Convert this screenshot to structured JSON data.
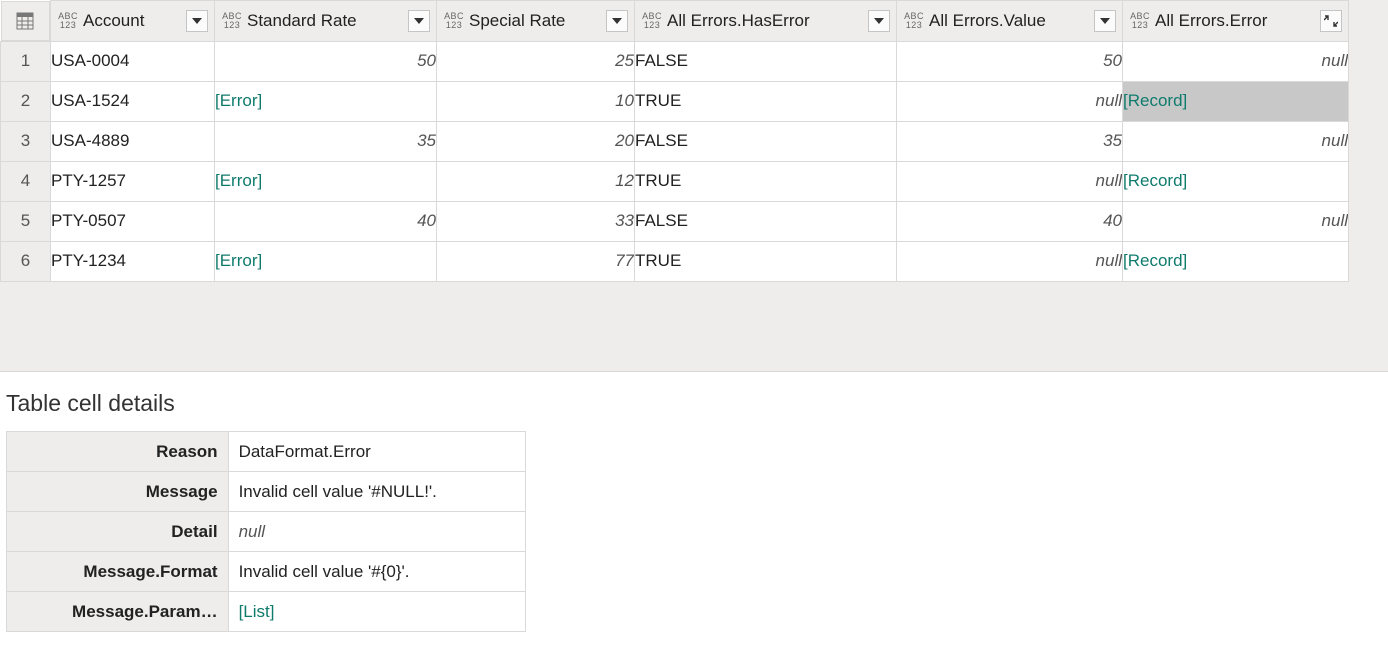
{
  "columns": {
    "account": "Account",
    "standardRate": "Standard Rate",
    "specialRate": "Special Rate",
    "hasError": "All Errors.HasError",
    "value": "All Errors.Value",
    "error": "All Errors.Error"
  },
  "rows": [
    {
      "n": "1",
      "account": "USA-0004",
      "std": "50",
      "std_is_err": false,
      "spc": "25",
      "has": "FALSE",
      "val": "50",
      "val_null": false,
      "err": "null",
      "err_link": false
    },
    {
      "n": "2",
      "account": "USA-1524",
      "std": "[Error]",
      "std_is_err": true,
      "spc": "10",
      "has": "TRUE",
      "val": "null",
      "val_null": true,
      "err": "[Record]",
      "err_link": true
    },
    {
      "n": "3",
      "account": "USA-4889",
      "std": "35",
      "std_is_err": false,
      "spc": "20",
      "has": "FALSE",
      "val": "35",
      "val_null": false,
      "err": "null",
      "err_link": false
    },
    {
      "n": "4",
      "account": "PTY-1257",
      "std": "[Error]",
      "std_is_err": true,
      "spc": "12",
      "has": "TRUE",
      "val": "null",
      "val_null": true,
      "err": "[Record]",
      "err_link": true
    },
    {
      "n": "5",
      "account": "PTY-0507",
      "std": "40",
      "std_is_err": false,
      "spc": "33",
      "has": "FALSE",
      "val": "40",
      "val_null": false,
      "err": "null",
      "err_link": false
    },
    {
      "n": "6",
      "account": "PTY-1234",
      "std": "[Error]",
      "std_is_err": true,
      "spc": "77",
      "has": "TRUE",
      "val": "null",
      "val_null": true,
      "err": "[Record]",
      "err_link": true
    }
  ],
  "selected": {
    "row": 1,
    "col": "err"
  },
  "details": {
    "title": "Table cell details",
    "items": [
      {
        "key": "Reason",
        "val": "DataFormat.Error",
        "ital": false,
        "link": false
      },
      {
        "key": "Message",
        "val": "Invalid cell value '#NULL!'.",
        "ital": false,
        "link": false
      },
      {
        "key": "Detail",
        "val": "null",
        "ital": true,
        "link": false
      },
      {
        "key": "Message.Format",
        "val": "Invalid cell value '#{0}'.",
        "ital": false,
        "link": false
      },
      {
        "key": "Message.Param…",
        "val": "[List]",
        "ital": false,
        "link": true
      }
    ]
  }
}
